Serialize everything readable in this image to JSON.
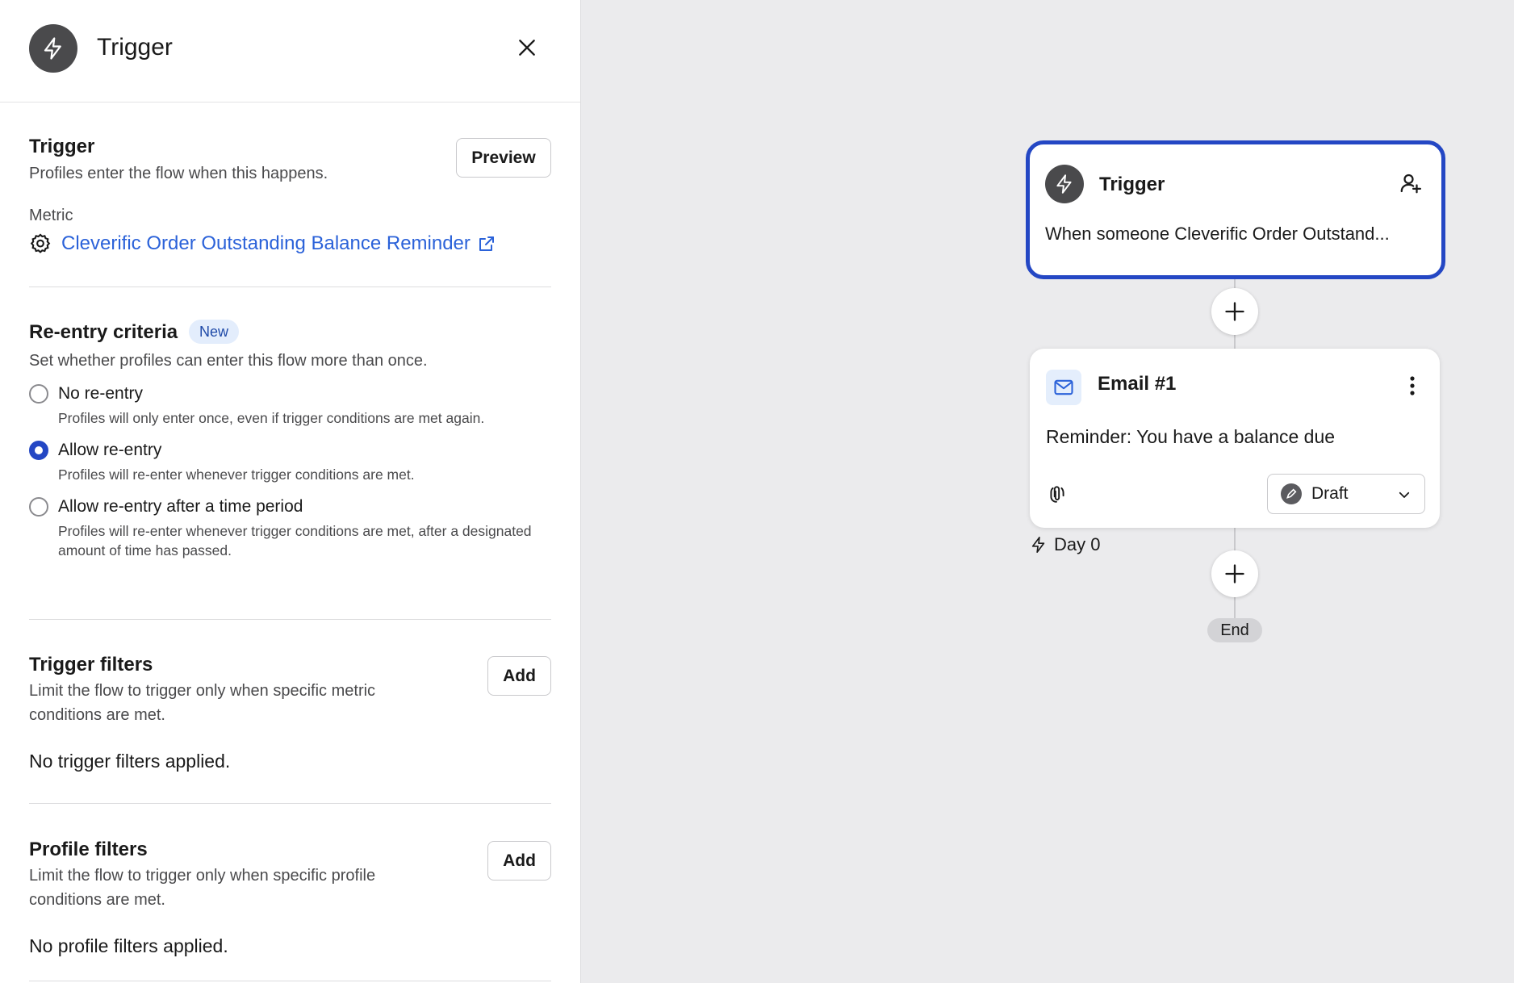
{
  "panel": {
    "header_title": "Trigger",
    "trigger_section": {
      "title": "Trigger",
      "description": "Profiles enter the flow when this happens.",
      "preview_label": "Preview",
      "metric_label": "Metric",
      "metric_name": "Cleverific Order Outstanding Balance Reminder"
    },
    "reentry_section": {
      "title": "Re-entry criteria",
      "badge": "New",
      "description": "Set whether profiles can enter this flow more than once.",
      "options": [
        {
          "label": "No re-entry",
          "help": "Profiles will only enter once, even if trigger conditions are met again.",
          "selected": false
        },
        {
          "label": "Allow re-entry",
          "help": "Profiles will re-enter whenever trigger conditions are met.",
          "selected": true
        },
        {
          "label": "Allow re-entry after a time period",
          "help": "Profiles will re-enter whenever trigger conditions are met, after a designated amount of time has passed.",
          "selected": false
        }
      ]
    },
    "trigger_filters": {
      "title": "Trigger filters",
      "description": "Limit the flow to trigger only when specific metric conditions are met.",
      "add_label": "Add",
      "empty_text": "No trigger filters applied."
    },
    "profile_filters": {
      "title": "Profile filters",
      "description": "Limit the flow to trigger only when specific profile conditions are met.",
      "add_label": "Add",
      "empty_text": "No profile filters applied."
    }
  },
  "canvas": {
    "trigger_card": {
      "title": "Trigger",
      "description": "When someone Cleverific Order Outstand..."
    },
    "email_card": {
      "title": "Email #1",
      "subject": "Reminder: You have a balance due",
      "status": "Draft"
    },
    "delay_label": "Day 0",
    "end_label": "End"
  },
  "colors": {
    "accent": "#2447c4",
    "link": "#2b62d9",
    "canvas_bg": "#ebebed",
    "icon_dark": "#4a4a4c"
  },
  "icons": [
    "lightning-icon",
    "close-icon",
    "gear-icon",
    "external-link-icon",
    "add-person-icon",
    "mail-icon",
    "kebab-menu-icon",
    "link-icon",
    "draft-icon",
    "chevron-down-icon",
    "plus-icon"
  ]
}
